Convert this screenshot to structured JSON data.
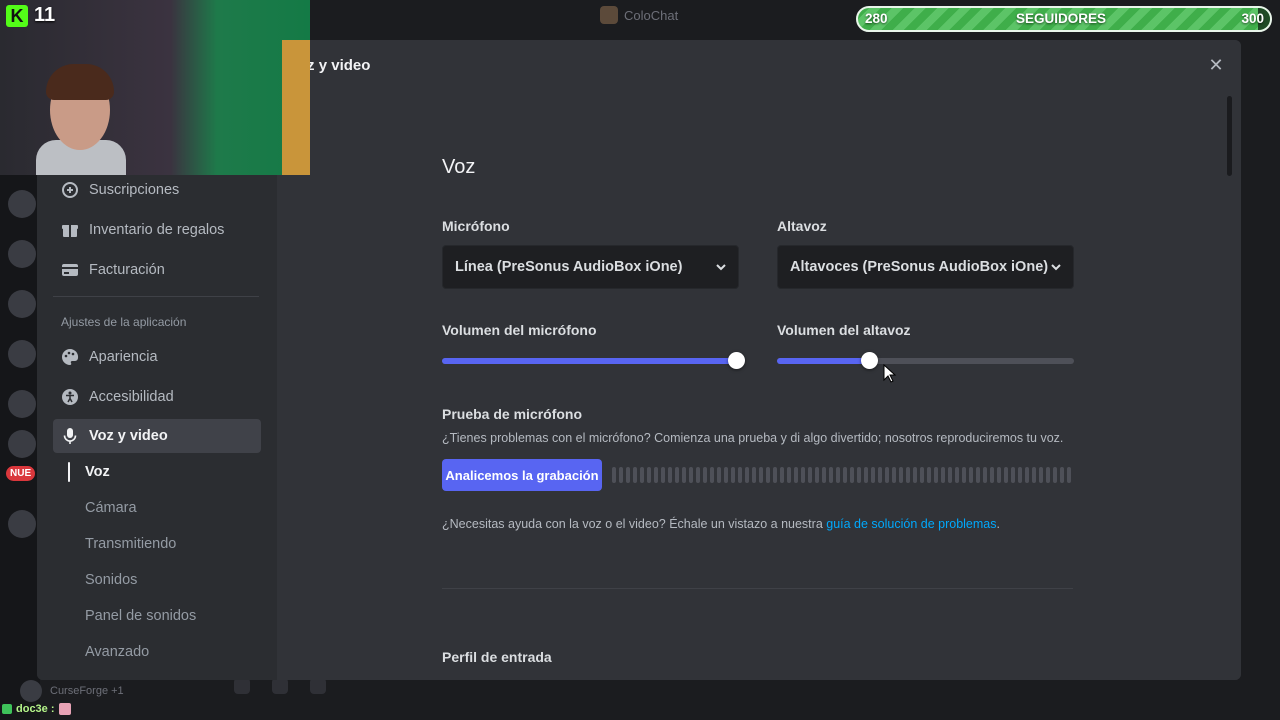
{
  "background": {
    "app_title": "ColoChat",
    "new_badge": "NUE",
    "user_status": "CurseForge +1",
    "chat_user": "doc3e :"
  },
  "overlay": {
    "stream_counter": "11",
    "follower_goal": {
      "start": "280",
      "label": "SEGUIDORES",
      "end": "300",
      "progress_percent": 97
    }
  },
  "modal": {
    "title": "Voz y video",
    "close_label": "✕"
  },
  "sidebar": {
    "items_top": [
      {
        "label": "Suscripciones",
        "icon": "subscriptions-icon"
      },
      {
        "label": "Inventario de regalos",
        "icon": "gift-icon"
      },
      {
        "label": "Facturación",
        "icon": "billing-card-icon"
      }
    ],
    "section_header": "Ajustes de la aplicación",
    "items_app": [
      {
        "label": "Apariencia",
        "icon": "palette-icon"
      },
      {
        "label": "Accesibilidad",
        "icon": "accessibility-icon"
      },
      {
        "label": "Voz y video",
        "icon": "microphone-icon",
        "active": true
      }
    ],
    "subitems": [
      {
        "label": "Voz",
        "active": true
      },
      {
        "label": "Cámara"
      },
      {
        "label": "Transmitiendo"
      },
      {
        "label": "Sonidos"
      },
      {
        "label": "Panel de sonidos"
      },
      {
        "label": "Avanzado"
      }
    ]
  },
  "voice": {
    "heading": "Voz",
    "mic_label": "Micrófono",
    "mic_device": "Línea (PreSonus AudioBox iOne)",
    "speaker_label": "Altavoz",
    "speaker_device": "Altavoces (PreSonus AudioBox iOne)",
    "mic_volume_label": "Volumen del micrófono",
    "mic_volume_fraction": 0.99,
    "speaker_volume_label": "Volumen del altavoz",
    "speaker_volume_fraction": 0.31,
    "mic_test_label": "Prueba de micrófono",
    "mic_test_desc": "¿Tienes problemas con el micrófono? Comienza una prueba y di algo divertido; nosotros reproduciremos tu voz.",
    "mic_test_button": "Analicemos la grabación",
    "help_text": "¿Necesitas ayuda con la voz o el video? Échale un vistazo a nuestra ",
    "help_link": "guía de solución de problemas",
    "help_end": ".",
    "input_profile_label": "Perfil de entrada"
  },
  "colors": {
    "accent": "#5865f2",
    "link": "#00a8fc",
    "active_item": "#404249"
  }
}
